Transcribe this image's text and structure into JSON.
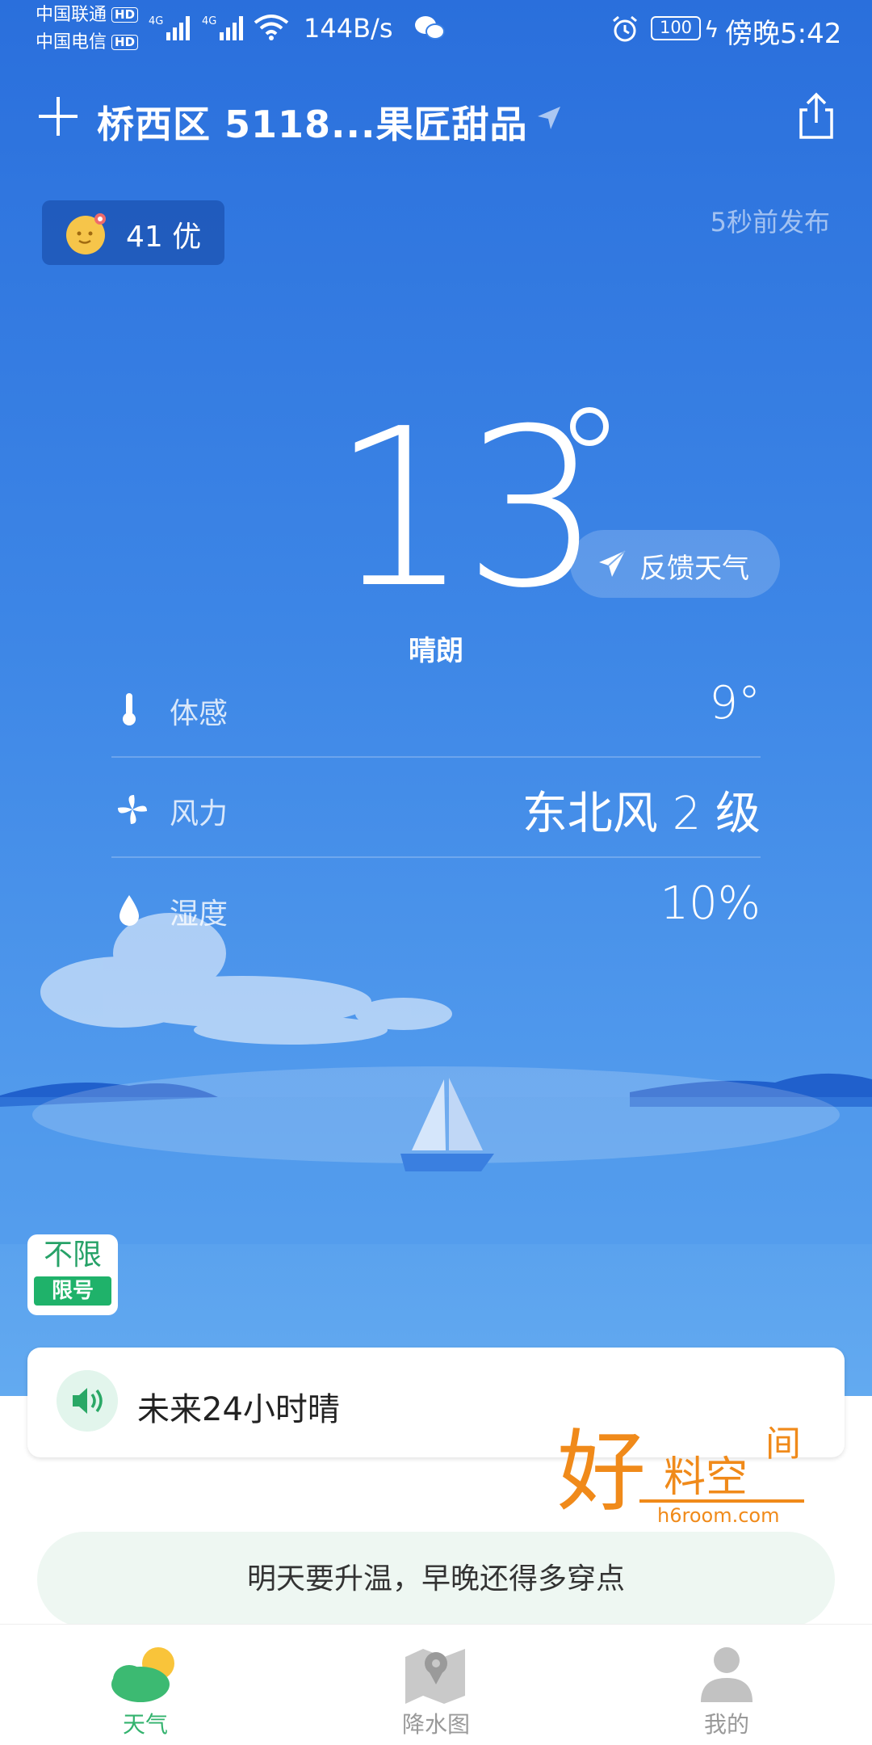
{
  "status_bar": {
    "carrier1": "中国联通",
    "carrier2": "中国电信",
    "hd": "HD",
    "net1": "4G",
    "net2": "4G",
    "speed": "144B/s",
    "battery": "100",
    "time": "傍晚5:42"
  },
  "header": {
    "location": "桥西区 5118...果匠甜品"
  },
  "aqi": {
    "text": "41 优"
  },
  "published": "5秒前发布",
  "current": {
    "temperature": "13",
    "condition": "晴朗",
    "feedback_label": "反馈天气"
  },
  "details": [
    {
      "label": "体感",
      "value": "9°",
      "icon": "thermometer-icon"
    },
    {
      "label": "风力",
      "value": "东北风 2 级",
      "icon": "fan-icon"
    },
    {
      "label": "湿度",
      "value": "10%",
      "icon": "drop-icon"
    }
  ],
  "limit": {
    "top": "不限",
    "bottom": "限号"
  },
  "alert": {
    "text": "未来24小时晴"
  },
  "watermark": {
    "big": "好",
    "mid": "料空",
    "small": "间",
    "url": "h6room.com"
  },
  "tip": "明天要升温，早晚还得多穿点",
  "tabs": [
    {
      "label": "天气",
      "active": true
    },
    {
      "label": "降水图",
      "active": false
    },
    {
      "label": "我的",
      "active": false
    }
  ],
  "colors": {
    "sky_top": "#2a6fdc",
    "sky_bottom": "#63aaf0",
    "accent_green": "#33b36e"
  }
}
